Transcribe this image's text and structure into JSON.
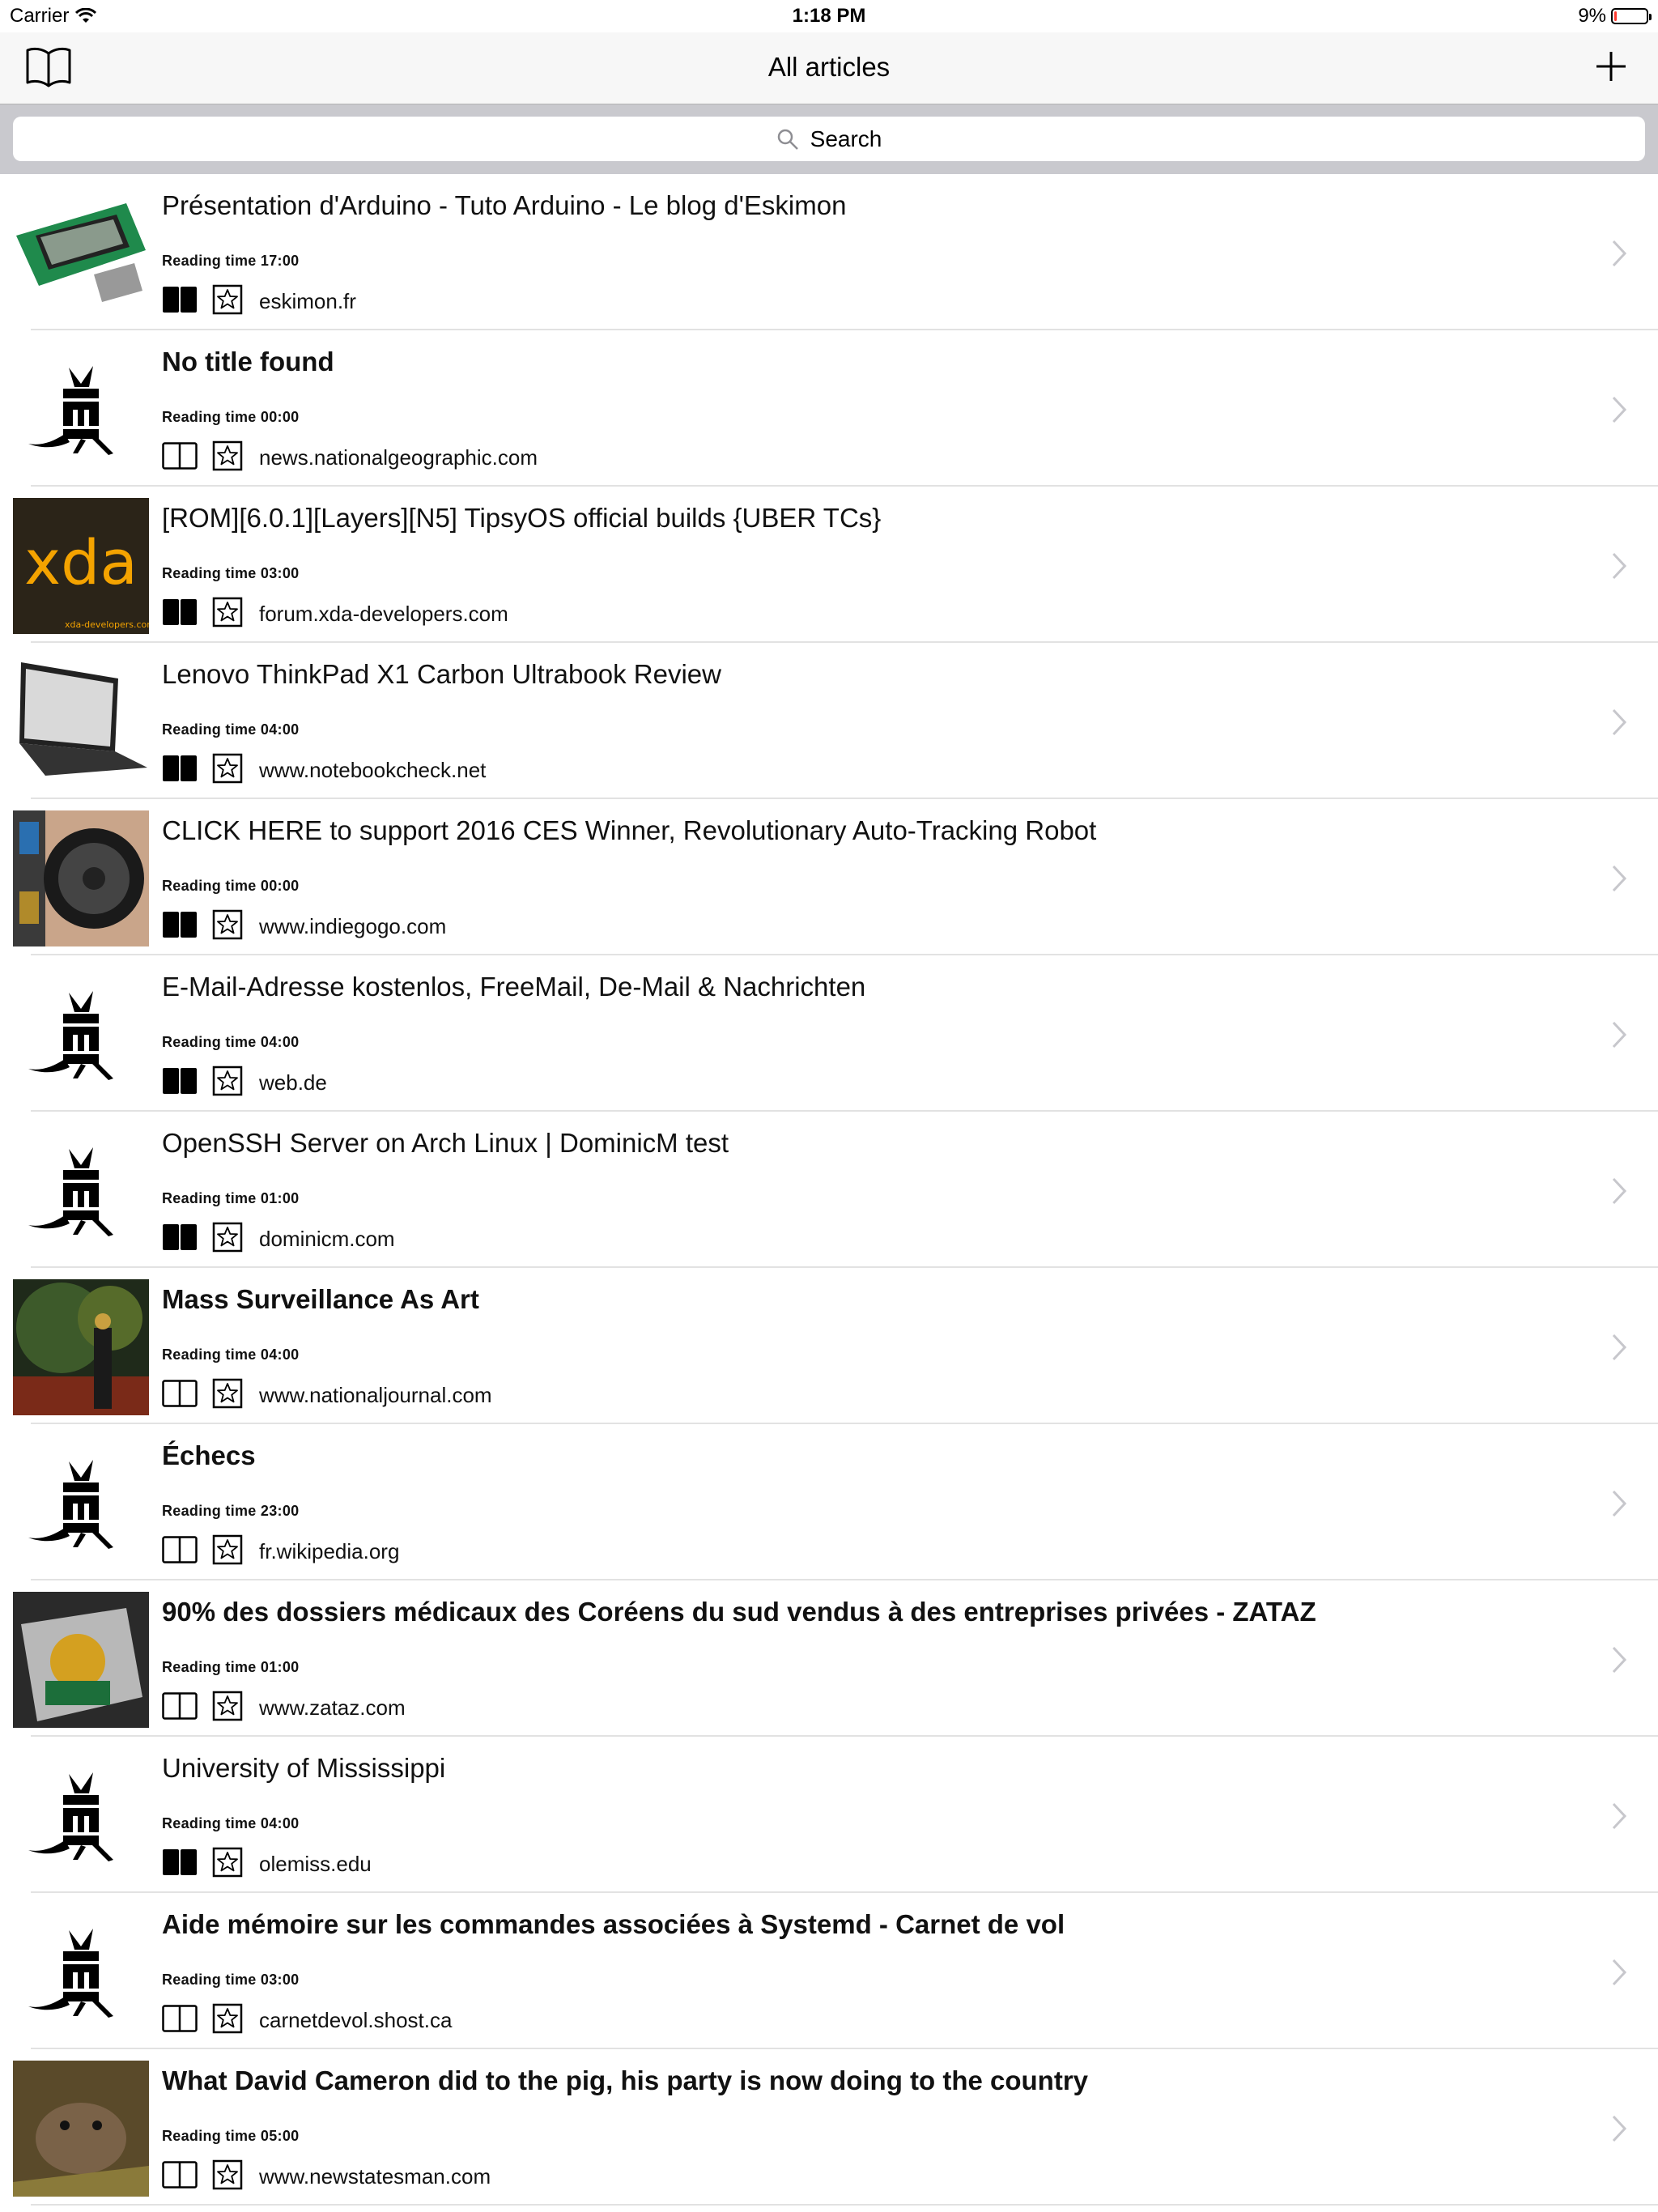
{
  "status_bar": {
    "carrier": "Carrier",
    "time": "1:18 PM",
    "battery_percent": "9%",
    "battery_level": 0.09
  },
  "nav": {
    "title": "All articles",
    "left_icon": "book-icon",
    "right_icon": "plus-icon"
  },
  "search": {
    "placeholder": "Search"
  },
  "articles": [
    {
      "title": "Présentation d'Arduino - Tuto Arduino - Le blog d'Eskimon",
      "bold": false,
      "reading": "Reading time 17:00",
      "domain": "eskimon.fr",
      "read": true,
      "thumb": "lcd-display"
    },
    {
      "title": "No title found",
      "bold": true,
      "reading": "Reading time 00:00",
      "domain": "news.nationalgeographic.com",
      "read": false,
      "thumb": "wallabag-logo"
    },
    {
      "title": "[ROM][6.0.1][Layers][N5] TipsyOS official builds {UBER TCs}",
      "bold": false,
      "reading": "Reading time 03:00",
      "domain": "forum.xda-developers.com",
      "read": true,
      "thumb": "xda",
      "thumb_text": "xda",
      "thumb_sub": "xda-developers.com"
    },
    {
      "title": "Lenovo ThinkPad X1 Carbon Ultrabook Review",
      "bold": false,
      "reading": "Reading time 04:00",
      "domain": "www.notebookcheck.net",
      "read": true,
      "thumb": "laptop"
    },
    {
      "title": "CLICK HERE to support 2016 CES Winner, Revolutionary Auto-Tracking Robot",
      "bold": false,
      "reading": "Reading time 00:00",
      "domain": "www.indiegogo.com",
      "read": true,
      "thumb": "robot"
    },
    {
      "title": "E-Mail-Adresse kostenlos, FreeMail, De-Mail & Nachrichten",
      "bold": false,
      "reading": "Reading time 04:00",
      "domain": "web.de",
      "read": true,
      "thumb": "wallabag-logo"
    },
    {
      "title": "OpenSSH Server on Arch Linux | DominicM test",
      "bold": false,
      "reading": "Reading time 01:00",
      "domain": "dominicm.com",
      "read": true,
      "thumb": "wallabag-logo"
    },
    {
      "title": "Mass Surveillance As Art",
      "bold": true,
      "reading": "Reading time 04:00",
      "domain": "www.nationaljournal.com",
      "read": false,
      "thumb": "tree"
    },
    {
      "title": "Échecs",
      "bold": true,
      "reading": "Reading time 23:00",
      "domain": "fr.wikipedia.org",
      "read": false,
      "thumb": "wallabag-logo"
    },
    {
      "title": "90% des dossiers médicaux des Coréens du sud vendus à des entreprises privées - ZATAZ",
      "bold": true,
      "reading": "Reading time 01:00",
      "domain": "www.zataz.com",
      "read": false,
      "thumb": "hard-drive"
    },
    {
      "title": "University of Mississippi",
      "bold": false,
      "reading": "Reading time 04:00",
      "domain": "olemiss.edu",
      "read": true,
      "thumb": "wallabag-logo"
    },
    {
      "title": "Aide mémoire sur les commandes associées à Systemd - Carnet de vol",
      "bold": true,
      "reading": "Reading time 03:00",
      "domain": "carnetdevol.shost.ca",
      "read": false,
      "thumb": "wallabag-logo"
    },
    {
      "title": "What David Cameron did to the pig, his party is now doing to the country",
      "bold": true,
      "reading": "Reading time 05:00",
      "domain": "www.newstatesman.com",
      "read": false,
      "thumb": "animal"
    }
  ]
}
